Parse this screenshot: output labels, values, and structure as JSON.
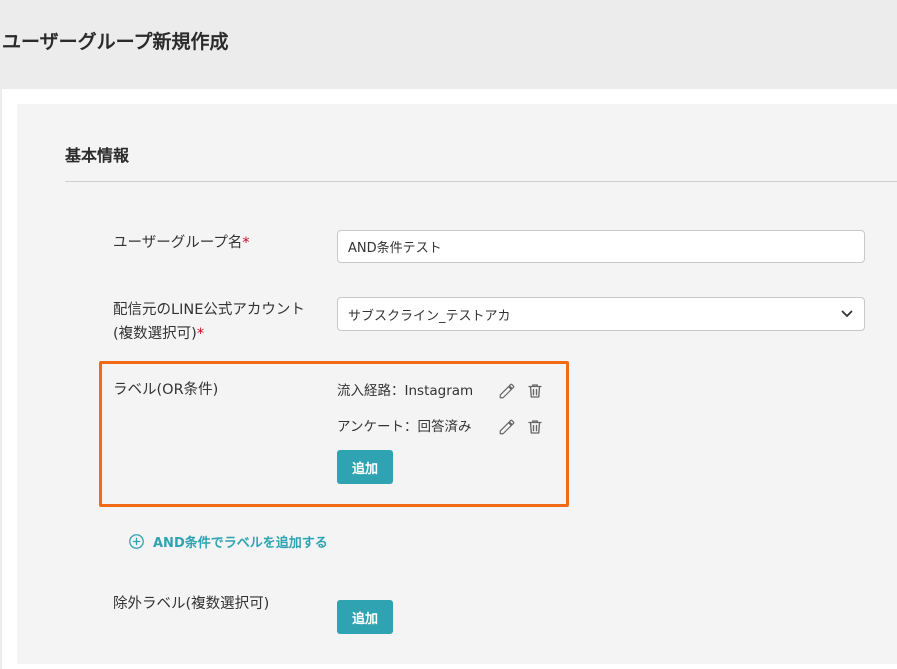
{
  "page": {
    "title": "ユーザーグループ新規作成"
  },
  "basic_info": {
    "section_title": "基本情報",
    "group_name": {
      "label": "ユーザーグループ名",
      "required_mark": "*",
      "value": "AND条件テスト"
    },
    "line_account": {
      "label_line1": "配信元のLINE公式アカウント",
      "label_line2": "(複数選択可)",
      "required_mark": "*",
      "selected_value": "サブスクライン_テストアカ"
    },
    "label_or": {
      "label": "ラベル(OR条件)",
      "items": [
        {
          "text": "流入経路：Instagram"
        },
        {
          "text": "アンケート：回答済み"
        }
      ],
      "add_button": "追加",
      "highlight_color": "#f26a13"
    },
    "and_condition_link": "AND条件でラベルを追加する",
    "exclude_label": {
      "label": "除外ラベル(複数選択可)",
      "add_button": "追加"
    }
  },
  "colors": {
    "accent": "#2fa3b2",
    "required": "#d0021b"
  },
  "icons": {
    "edit": "pencil-icon",
    "delete": "trash-icon",
    "add_condition": "plus-circle-icon",
    "dropdown": "chevron-down-icon"
  }
}
